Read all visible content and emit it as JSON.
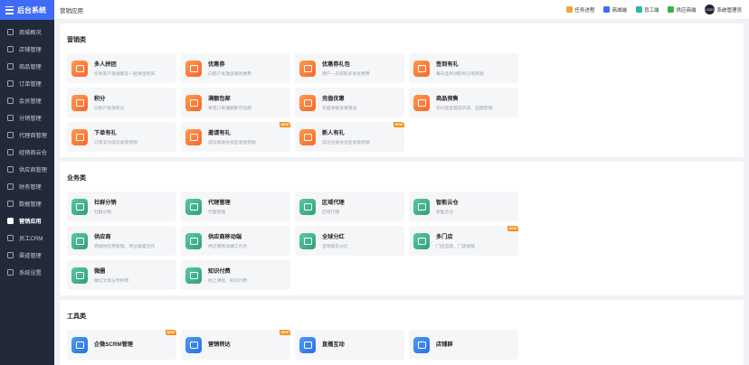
{
  "app": {
    "title": "后台系统"
  },
  "sidebar": {
    "items": [
      {
        "label": "商城概况",
        "icon": "dashboard-icon"
      },
      {
        "label": "店铺管理",
        "icon": "shop-icon"
      },
      {
        "label": "商品管理",
        "icon": "goods-icon"
      },
      {
        "label": "订单管理",
        "icon": "order-icon"
      },
      {
        "label": "会员管理",
        "icon": "member-icon"
      },
      {
        "label": "分销管理",
        "icon": "distribution-icon"
      },
      {
        "label": "代理商管理",
        "icon": "agent-icon"
      },
      {
        "label": "经销商云仓",
        "icon": "warehouse-icon"
      },
      {
        "label": "供应商管理",
        "icon": "supplier-icon"
      },
      {
        "label": "财务管理",
        "icon": "finance-icon"
      },
      {
        "label": "数据管理",
        "icon": "data-icon"
      },
      {
        "label": "营销应用",
        "icon": "marketing-icon",
        "active": true
      },
      {
        "label": "员工CRM",
        "icon": "crm-icon"
      },
      {
        "label": "渠道管理",
        "icon": "channel-icon"
      },
      {
        "label": "系统设置",
        "icon": "settings-icon"
      }
    ]
  },
  "header": {
    "breadcrumb": "营销应用",
    "tools": [
      {
        "label": "任务进程",
        "icon": "bell-icon"
      },
      {
        "label": "商城端",
        "icon": "store-icon"
      },
      {
        "label": "员工端",
        "icon": "staff-icon"
      },
      {
        "label": "供应商端",
        "icon": "supplier-icon"
      }
    ],
    "avatar_text": "LOGO",
    "user": "系统管理员"
  },
  "sections": [
    {
      "title": "营销类",
      "cards": [
        {
          "name": "多人拼团",
          "desc": "引导客户邀请朋友一起拼团购买",
          "color": "orange",
          "badge": ""
        },
        {
          "name": "优惠券",
          "desc": "向客户发放店铺优惠券",
          "color": "orange",
          "badge": ""
        },
        {
          "name": "优惠券礼包",
          "desc": "用户一次获取多张优惠券",
          "color": "orange",
          "badge": ""
        },
        {
          "name": "签到有礼",
          "desc": "每日签到领取积分或奖励",
          "color": "orange",
          "badge": ""
        },
        {
          "name": "积分",
          "desc": "向客户发放积分",
          "color": "orange",
          "badge": ""
        },
        {
          "name": "满额包邮",
          "desc": "单笔订单满额即可包邮",
          "color": "orange",
          "badge": ""
        },
        {
          "name": "充值优惠",
          "desc": "充值余额优惠赠送",
          "color": "orange",
          "badge": ""
        },
        {
          "name": "商品预售",
          "desc": "先付定金提前开卖、后期营销",
          "color": "orange",
          "badge": ""
        },
        {
          "name": "下单有礼",
          "desc": "订单支付成功发放奖励",
          "color": "orange",
          "badge": ""
        },
        {
          "name": "邀请有礼",
          "desc": "成功邀请会员后发放奖励",
          "color": "orange",
          "badge": "NEW"
        },
        {
          "name": "新人有礼",
          "desc": "成功注册会员后发放奖励",
          "color": "orange",
          "badge": "NEW"
        }
      ]
    },
    {
      "title": "业务类",
      "cards": [
        {
          "name": "社群分销",
          "desc": "社群分销",
          "color": "green",
          "badge": ""
        },
        {
          "name": "代理管理",
          "desc": "代理管理",
          "color": "green",
          "badge": ""
        },
        {
          "name": "区域代理",
          "desc": "区域代理",
          "color": "green",
          "badge": ""
        },
        {
          "name": "智能云仓",
          "desc": "智能云仓",
          "color": "green",
          "badge": ""
        },
        {
          "name": "供应商",
          "desc": "商城供应商管理、商业联盟合作",
          "color": "green",
          "badge": ""
        },
        {
          "name": "供应商移动端",
          "desc": "供应商移动端工作台",
          "color": "green",
          "badge": ""
        },
        {
          "name": "全球分红",
          "desc": "全球股东分红",
          "color": "green",
          "badge": ""
        },
        {
          "name": "多门店",
          "desc": "门店自提、门店核销",
          "color": "green",
          "badge": "NEW"
        },
        {
          "name": "微圈",
          "desc": "微信文章分享种草",
          "color": "green",
          "badge": ""
        },
        {
          "name": "知识付费",
          "desc": "线上课程、知识付费",
          "color": "green",
          "badge": ""
        }
      ]
    },
    {
      "title": "工具类",
      "cards": [
        {
          "name": "企微SCRM管理",
          "desc": "",
          "color": "blue",
          "badge": "NEW"
        },
        {
          "name": "营销转达",
          "desc": "",
          "color": "blue",
          "badge": "NEW"
        },
        {
          "name": "直播互动",
          "desc": "",
          "color": "blue",
          "badge": ""
        },
        {
          "name": "店铺群",
          "desc": "",
          "color": "blue",
          "badge": ""
        }
      ]
    }
  ]
}
